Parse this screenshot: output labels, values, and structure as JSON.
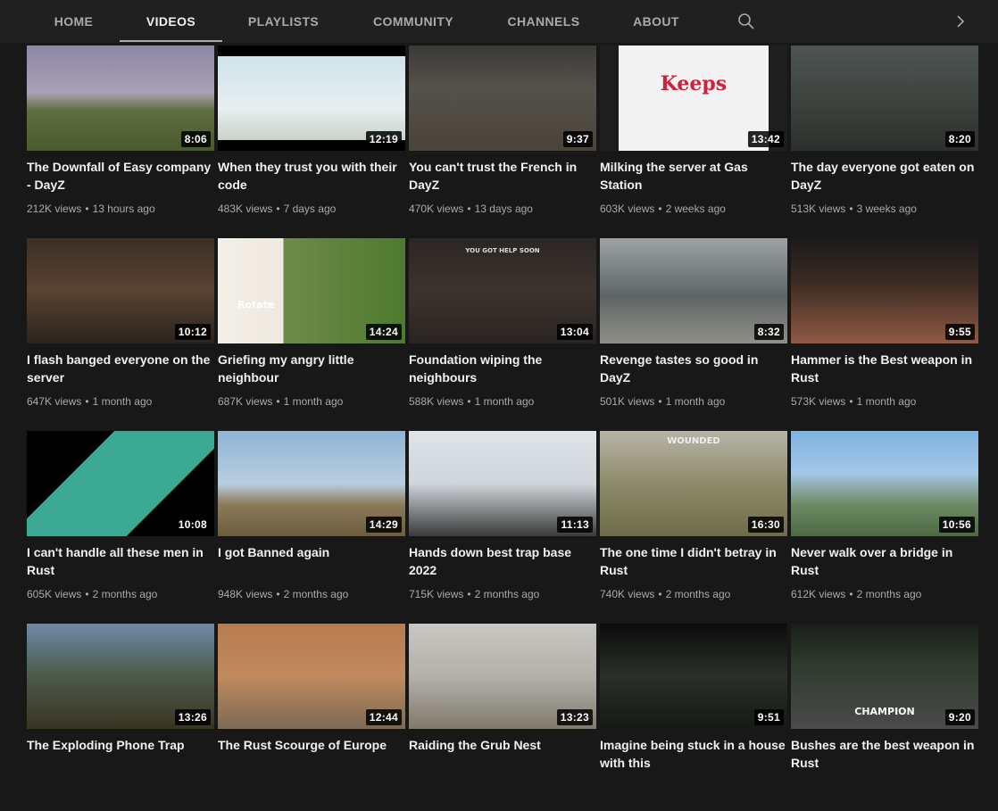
{
  "tabs": [
    {
      "label": "HOME",
      "active": false
    },
    {
      "label": "VIDEOS",
      "active": true
    },
    {
      "label": "PLAYLISTS",
      "active": false
    },
    {
      "label": "COMMUNITY",
      "active": false
    },
    {
      "label": "CHANNELS",
      "active": false
    },
    {
      "label": "ABOUT",
      "active": false
    }
  ],
  "icons": {
    "search": "search-icon",
    "next": "chevron-right-icon"
  },
  "colors": {
    "background": "#181818",
    "tabbar": "#202020",
    "text": "#f1f1f1",
    "muted": "#aaaaaa"
  },
  "videos": [
    {
      "title": "The Downfall of Easy company - DayZ",
      "views": "212K views",
      "age": "13 hours ago",
      "duration": "8:06"
    },
    {
      "title": "When they trust you with their code",
      "views": "483K views",
      "age": "7 days ago",
      "duration": "12:19"
    },
    {
      "title": "You can't trust the French in DayZ",
      "views": "470K views",
      "age": "13 days ago",
      "duration": "9:37"
    },
    {
      "title": "Milking the server at Gas Station",
      "views": "603K views",
      "age": "2 weeks ago",
      "duration": "13:42",
      "thumb_text": "Keeps"
    },
    {
      "title": "The day everyone got eaten on DayZ",
      "views": "513K views",
      "age": "3 weeks ago",
      "duration": "8:20"
    },
    {
      "title": "I flash banged everyone on the server",
      "views": "647K views",
      "age": "1 month ago",
      "duration": "10:12"
    },
    {
      "title": "Griefing my angry little neighbour",
      "views": "687K views",
      "age": "1 month ago",
      "duration": "14:24",
      "thumb_text": "Rotate"
    },
    {
      "title": "Foundation wiping the neighbours",
      "views": "588K views",
      "age": "1 month ago",
      "duration": "13:04",
      "thumb_text": "YOU GOT HELP SOON"
    },
    {
      "title": "Revenge tastes so good in DayZ",
      "views": "501K views",
      "age": "1 month ago",
      "duration": "8:32"
    },
    {
      "title": "Hammer is the Best weapon in Rust",
      "views": "573K views",
      "age": "1 month ago",
      "duration": "9:55"
    },
    {
      "title": "I can't handle all these men in Rust",
      "views": "605K views",
      "age": "2 months ago",
      "duration": "10:08"
    },
    {
      "title": "I got Banned again",
      "views": "948K views",
      "age": "2 months ago",
      "duration": "14:29"
    },
    {
      "title": "Hands down best trap base 2022",
      "views": "715K views",
      "age": "2 months ago",
      "duration": "11:13"
    },
    {
      "title": "The one time I didn't betray in Rust",
      "views": "740K views",
      "age": "2 months ago",
      "duration": "16:30",
      "thumb_text": "WOUNDED"
    },
    {
      "title": "Never walk over a bridge in Rust",
      "views": "612K views",
      "age": "2 months ago",
      "duration": "10:56"
    },
    {
      "title": "The Exploding Phone Trap",
      "views": "",
      "age": "",
      "duration": "13:26"
    },
    {
      "title": "The Rust Scourge of Europe",
      "views": "",
      "age": "",
      "duration": "12:44"
    },
    {
      "title": "Raiding the Grub Nest",
      "views": "",
      "age": "",
      "duration": "13:23"
    },
    {
      "title": "Imagine being stuck in a house with this",
      "views": "",
      "age": "",
      "duration": "9:51"
    },
    {
      "title": "Bushes are the best weapon in Rust",
      "views": "",
      "age": "",
      "duration": "9:20",
      "thumb_text": "CHAMPION"
    }
  ]
}
